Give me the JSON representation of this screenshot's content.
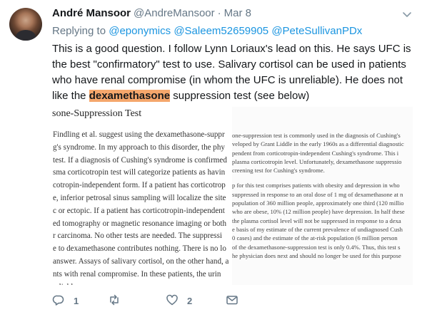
{
  "tweet": {
    "author_name": "André Mansoor",
    "author_handle": "@AndreMansoor",
    "separator": "·",
    "timestamp": "Mar 8",
    "replying_prefix": "Replying to",
    "replying_to": [
      "@eponymics",
      "@Saleem52659905",
      "@PeteSullivanPDx"
    ],
    "text_before": "This is a good question. I follow Lynn Loriaux's lead on this. He says UFC is the best \"confirmatory\" test to use. Salivary cortisol can be used in patients who have renal compromise (in whom the UFC is unreliable). He does not like the ",
    "text_highlight": "dexamethasone",
    "text_after": " suppression test (see below)",
    "highlight_color": "#f5a76c"
  },
  "media": {
    "left_title": "sone-Suppression Test",
    "left_lines": [
      "Findling et al. suggest using the dexamethasone-suppr",
      "g's syndrome. In my approach to this disorder, the phy",
      "test. If a diagnosis of Cushing's syndrome is confirmed",
      "sma corticotropin test will categorize patients as havin",
      "cotropin-independent form. If a patient has corticotrop",
      "e, inferior petrosal sinus sampling will localize the site",
      "c or ectopic. If a patient has corticotropin-independent",
      "ed tomography or magnetic resonance imaging or both",
      "r carcinoma. No other tests are needed. The suppressi",
      "e to dexamethasone contributes nothing. There is no lo",
      "answer. Assays of salivary cortisol, on the other hand, a",
      "nts with renal compromise. In these patients, the urin",
      "reliable."
    ],
    "right_lines_a": [
      "one-suppression test is commonly used in the diagnosis of Cushing's",
      "veloped by Grant Liddle in the early 1960s as a differential diagnostic",
      "pendent from corticotropin-independent Cushing's syndrome. This i",
      "plasma corticotropin level. Unfortunately, dexamethasone suppressio",
      "creening test for Cushing's syndrome."
    ],
    "right_lines_b": [
      "p for this test comprises patients with obesity and depression in who",
      "suppressed in response to an oral dose of 1 mg of dexamethasone at n",
      "population of 360 million people, approximately one third (120 millio",
      "who are obese, 10% (12 million people) have depression. In half these",
      "the plasma cortisol level will not be suppressed in response to a dexa",
      "e basis of my estimate of the current prevalence of undiagnosed Cush",
      "0 cases) and the estimate of the at-risk population (6 million person",
      "of the dexamethasone-suppression test is only 0.4%. Thus, this test s",
      "he physician does next and should no longer be used for this purpose"
    ]
  },
  "actions": {
    "reply_count": "1",
    "retweet_count": "",
    "like_count": "2",
    "icons": [
      "reply-icon",
      "retweet-icon",
      "like-icon",
      "message-icon"
    ]
  }
}
